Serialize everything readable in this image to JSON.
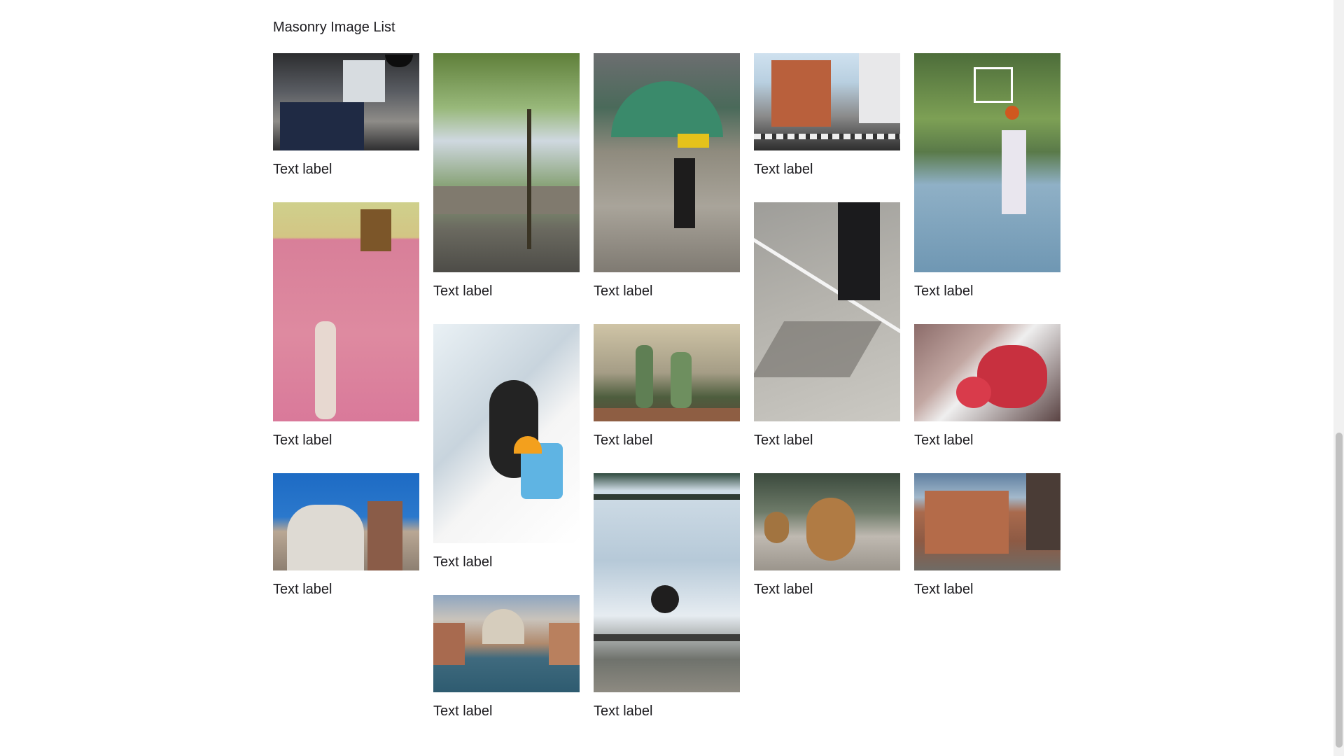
{
  "page": {
    "title": "Masonry Image List"
  },
  "columns": [
    {
      "items": [
        {
          "image": "cafe-interior",
          "label": "Text label"
        },
        {
          "image": "statue-pink-wall",
          "label": "Text label"
        },
        {
          "image": "lion-statue-tower",
          "label": "Text label"
        }
      ]
    },
    {
      "items": [
        {
          "image": "park-lamp-railing",
          "label": "Text label"
        },
        {
          "image": "woman-ice-cream",
          "label": "Text label"
        },
        {
          "image": "venice-canal",
          "label": "Text label"
        }
      ]
    },
    {
      "items": [
        {
          "image": "market-cyclist",
          "label": "Text label"
        },
        {
          "image": "cactus-shop",
          "label": "Text label"
        },
        {
          "image": "child-swing",
          "label": "Text label"
        }
      ]
    },
    {
      "items": [
        {
          "image": "brick-building-street",
          "label": "Text label"
        },
        {
          "image": "cyclist-road-shadow",
          "label": "Text label"
        },
        {
          "image": "shar-pei-dog",
          "label": "Text label"
        }
      ]
    },
    {
      "items": [
        {
          "image": "basketball-player",
          "label": "Text label"
        },
        {
          "image": "red-flowers",
          "label": "Text label"
        },
        {
          "image": "brick-townhouses",
          "label": "Text label"
        }
      ]
    }
  ]
}
